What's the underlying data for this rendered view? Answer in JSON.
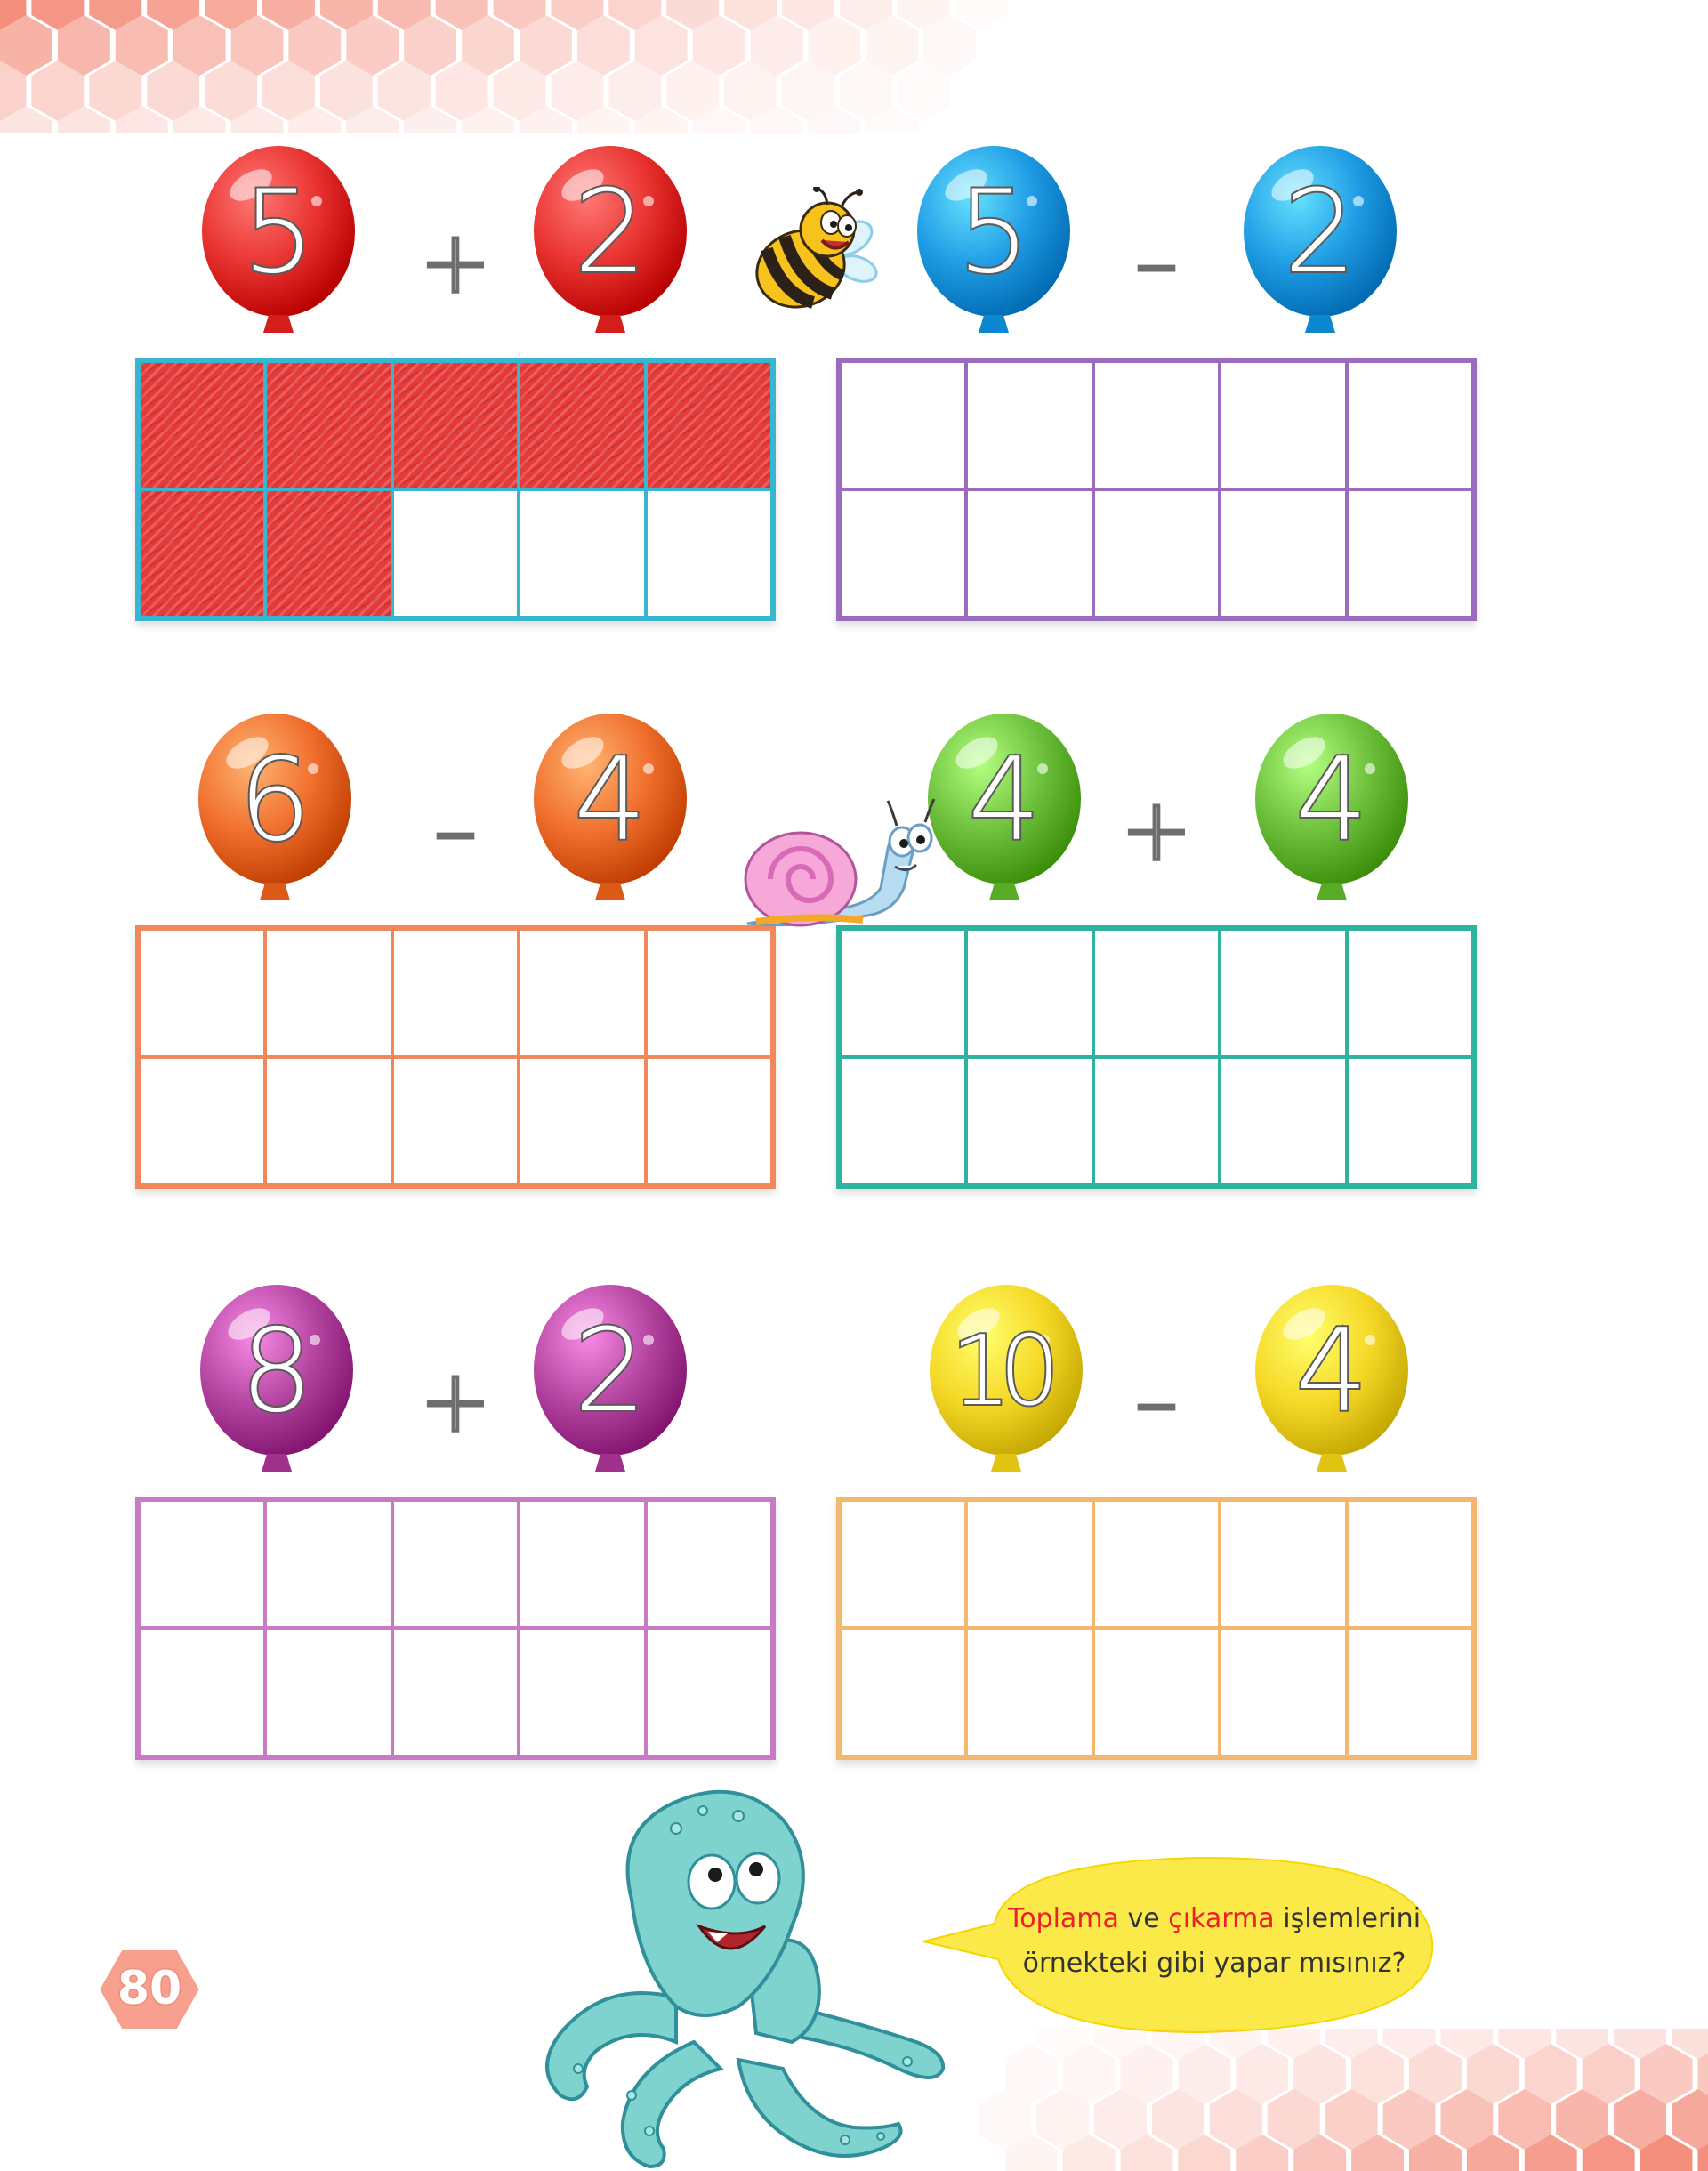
{
  "page_number": "80",
  "colors": {
    "hexagon": "#f48f7e",
    "page_badge": "#f7a08f",
    "bubble": "#fbe94a",
    "highlight_red": "#e8202a",
    "balloon_red": "#e8322f",
    "balloon_blue": "#1e9be3",
    "balloon_orange": "#f06e2c",
    "balloon_green": "#6cbf3a",
    "balloon_purple": "#b3449f",
    "balloon_yellow": "#f5d826",
    "frame_cyan": "#39b6cf",
    "frame_purple": "#9b6bbd",
    "frame_orange": "#f0885a",
    "frame_teal": "#2fb39e",
    "frame_pink": "#c97ac7",
    "frame_amber": "#f3b86e",
    "fill_red": "#e53a3a"
  },
  "problems": [
    {
      "left": "5",
      "op": "+",
      "right": "2",
      "balloon_color": "balloon_red",
      "frame_color": "frame_cyan",
      "filled": 7
    },
    {
      "left": "5",
      "op": "–",
      "right": "2",
      "balloon_color": "balloon_blue",
      "frame_color": "frame_purple",
      "filled": 0
    },
    {
      "left": "6",
      "op": "–",
      "right": "4",
      "balloon_color": "balloon_orange",
      "frame_color": "frame_orange",
      "filled": 0
    },
    {
      "left": "4",
      "op": "+",
      "right": "4",
      "balloon_color": "balloon_green",
      "frame_color": "frame_teal",
      "filled": 0
    },
    {
      "left": "8",
      "op": "+",
      "right": "2",
      "balloon_color": "balloon_purple",
      "frame_color": "frame_pink",
      "filled": 0
    },
    {
      "left": "10",
      "op": "–",
      "right": "4",
      "balloon_color": "balloon_yellow",
      "frame_color": "frame_amber",
      "filled": 0
    }
  ],
  "instruction": {
    "word1": "Toplama",
    "text1": " ve ",
    "word2": "çıkarma",
    "text2": " işlemlerini",
    "line2": "örnekteki gibi yapar mısınız?"
  },
  "icons": {
    "bee": "bee-icon",
    "snail": "snail-icon",
    "octopus": "octopus-icon"
  }
}
